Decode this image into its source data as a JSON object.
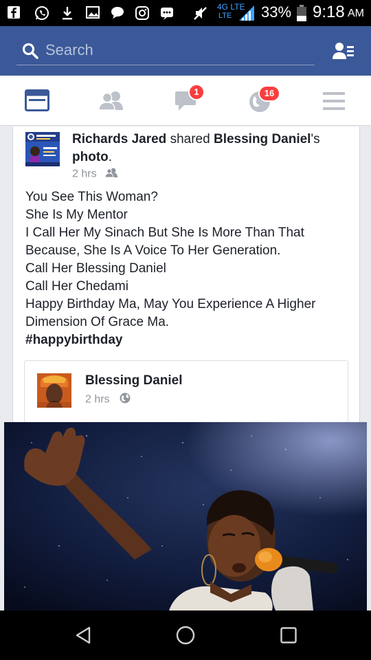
{
  "status_bar": {
    "network": "4G LTE",
    "network_sub": "LTE",
    "battery": "33%",
    "time": "9:18",
    "ampm": "AM"
  },
  "search": {
    "placeholder": "Search"
  },
  "nav": {
    "messages_badge": "1",
    "notifications_badge": "16"
  },
  "post": {
    "author": "Richards Jared",
    "shared_word": "shared",
    "target": "Blessing Daniel",
    "possessive": "'s",
    "object": "photo",
    "time": "2 hrs",
    "lines": [
      "You See This Woman?",
      "She Is My Mentor",
      "I Call Her My Sinach But She Is More Than That",
      "Because, She Is A Voice To Her Generation.",
      "Call Her Blessing Daniel",
      "Call Her Chedami",
      "Happy Birthday Ma, May You Experience A Higher",
      "Dimension Of Grace Ma."
    ],
    "hashtag": "#happybirthday",
    "shared_post": {
      "author": "Blessing Daniel",
      "time": "2 hrs"
    }
  },
  "colors": {
    "facebook_blue": "#3b5998",
    "badge_red": "#fa3e3e"
  }
}
